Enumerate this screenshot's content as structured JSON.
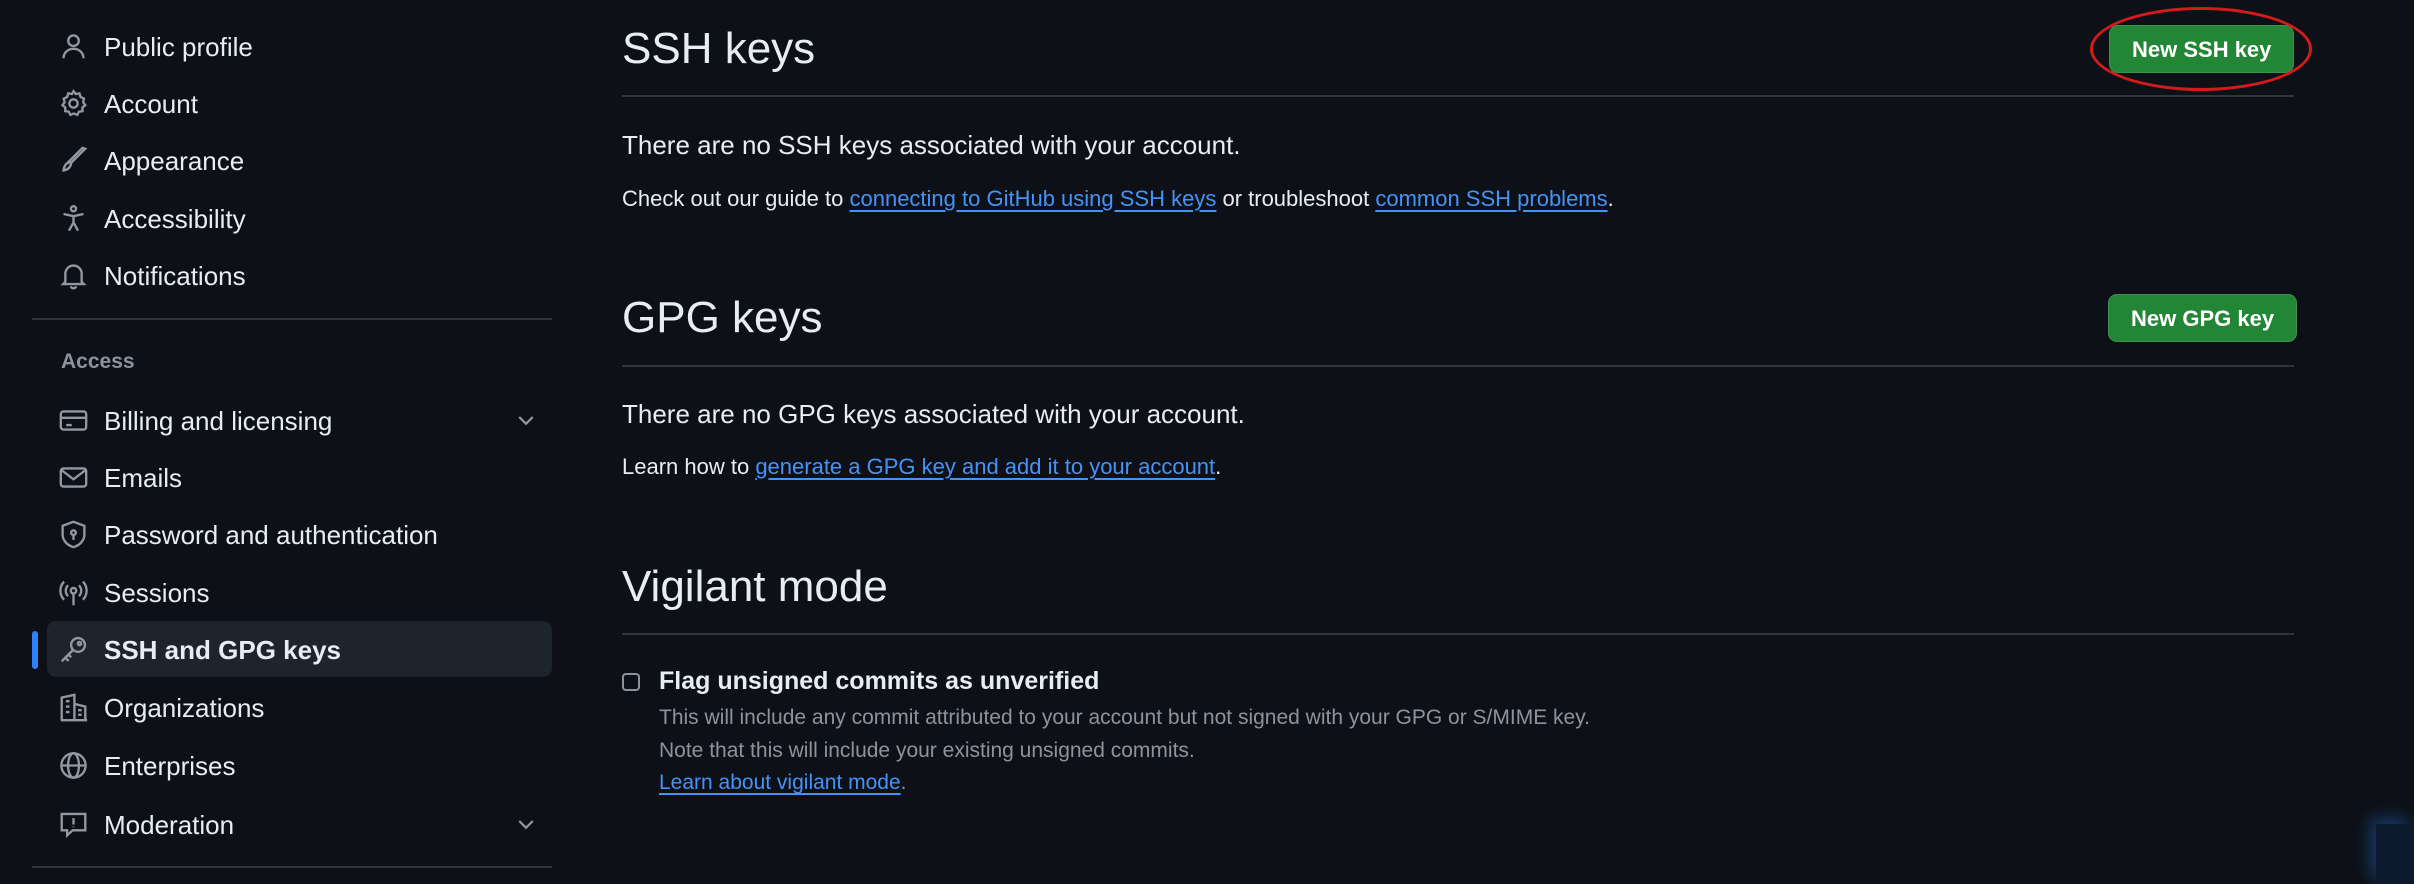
{
  "sidebar": {
    "items": [
      {
        "label": "Public profile",
        "icon": "person-icon"
      },
      {
        "label": "Account",
        "icon": "gear-icon"
      },
      {
        "label": "Appearance",
        "icon": "paintbrush-icon"
      },
      {
        "label": "Accessibility",
        "icon": "accessibility-icon"
      },
      {
        "label": "Notifications",
        "icon": "bell-icon"
      }
    ],
    "access_label": "Access",
    "access_items": [
      {
        "label": "Billing and licensing",
        "icon": "credit-card-icon",
        "expandable": true
      },
      {
        "label": "Emails",
        "icon": "mail-icon"
      },
      {
        "label": "Password and authentication",
        "icon": "shield-lock-icon"
      },
      {
        "label": "Sessions",
        "icon": "broadcast-icon"
      },
      {
        "label": "SSH and GPG keys",
        "icon": "key-icon",
        "active": true
      },
      {
        "label": "Organizations",
        "icon": "organization-icon"
      },
      {
        "label": "Enterprises",
        "icon": "globe-icon"
      },
      {
        "label": "Moderation",
        "icon": "report-icon",
        "expandable": true
      }
    ]
  },
  "ssh": {
    "title": "SSH keys",
    "button": "New SSH key",
    "empty": "There are no SSH keys associated with your account.",
    "guide_prefix": "Check out our guide to ",
    "guide_link": "connecting to GitHub using SSH keys",
    "guide_middle": " or troubleshoot ",
    "problems_link": "common SSH problems",
    "guide_suffix": "."
  },
  "gpg": {
    "title": "GPG keys",
    "button": "New GPG key",
    "empty": "There are no GPG keys associated with your account.",
    "learn_prefix": "Learn how to ",
    "learn_link": "generate a GPG key and add it to your account",
    "learn_suffix": "."
  },
  "vigilant": {
    "title": "Vigilant mode",
    "checkbox_label": "Flag unsigned commits as unverified",
    "checked": false,
    "desc1": "This will include any commit attributed to your account but not signed with your GPG or S/MIME key.",
    "desc2": "Note that this will include your existing unsigned commits.",
    "learn_link": "Learn about vigilant mode",
    "learn_suffix": "."
  },
  "colors": {
    "background": "#0d1117",
    "accent": "#2f81f7",
    "link": "#4493f8",
    "button_green": "#238636",
    "highlight": "#d41b1b"
  }
}
